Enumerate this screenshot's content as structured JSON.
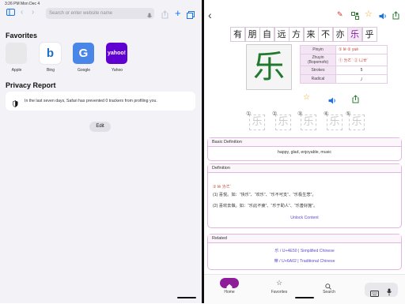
{
  "safari": {
    "status_time": "3:26 PM   Mon Dec 4",
    "url_placeholder": "Search or enter website name",
    "favorites_title": "Favorites",
    "favorites": [
      {
        "label": "Apple",
        "icon": "apple-logo-icon",
        "glyph": "",
        "bg": "#e8e8ea",
        "fg": "#555"
      },
      {
        "label": "Bing",
        "icon": "bing-logo-icon",
        "glyph": "b",
        "bg": "#ffffff",
        "fg": "#1b6fc8"
      },
      {
        "label": "Google",
        "icon": "google-logo-icon",
        "glyph": "G",
        "bg": "#4a86e8",
        "fg": "#ffffff"
      },
      {
        "label": "Yahoo",
        "icon": "yahoo-logo-icon",
        "glyph": "yahoo!",
        "bg": "#6001d2",
        "fg": "#ffffff"
      }
    ],
    "privacy_title": "Privacy Report",
    "privacy_text": "In the last seven days, Safari has prevented 0 trackers from profiling you.",
    "edit_label": "Edit"
  },
  "dict": {
    "colors": {
      "accent": "#8e1d9a",
      "character": "#1f7a2e",
      "pinyin": "#c0392b",
      "link": "#5e4bd1"
    },
    "sentence_chars": [
      "有",
      "朋",
      "自",
      "远",
      "方",
      "来",
      "不",
      "亦",
      "乐",
      "乎"
    ],
    "active_index": 8,
    "character": "乐",
    "info": {
      "pinyin_label": "Pinyin",
      "pinyin_value": "① lè  ② yuè",
      "zhuyin_label": "Zhuyin (Bopomofo)",
      "zhuyin_value": "① ㄌㄜˋ  ② ㄩㄝˋ",
      "strokes_label": "Strokes",
      "strokes_value": "5",
      "radical_label": "Radical",
      "radical_value": "丿"
    },
    "stroke_numbers": [
      "①",
      "②",
      "③",
      "④",
      "⑤"
    ],
    "basic_title": "Basic Definition",
    "basic_text": "happy, glad, enjoyable, music",
    "definition_title": "Definition",
    "definition_reading": "① lè  ㄌㄜˋ",
    "definition_lines": [
      "(1)  喜悦。如：“快乐”、“欢乐”、“乐不可支”、“乐极生悲”。",
      "(2)  喜欢去做。如：“乐此不疲”、“乐于助人”、“乐善好施”。"
    ],
    "unlock_label": "Unlock Content",
    "related_title": "Related",
    "related_simplified": "乐 / U+4E50 | Simplified Chinese",
    "related_traditional": "樂 / U+6A02 | Traditional Chinese",
    "nav": [
      {
        "label": "Home",
        "icon": "home-icon"
      },
      {
        "label": "Favorites",
        "icon": "star-icon"
      },
      {
        "label": "Search",
        "icon": "search-icon"
      }
    ]
  }
}
